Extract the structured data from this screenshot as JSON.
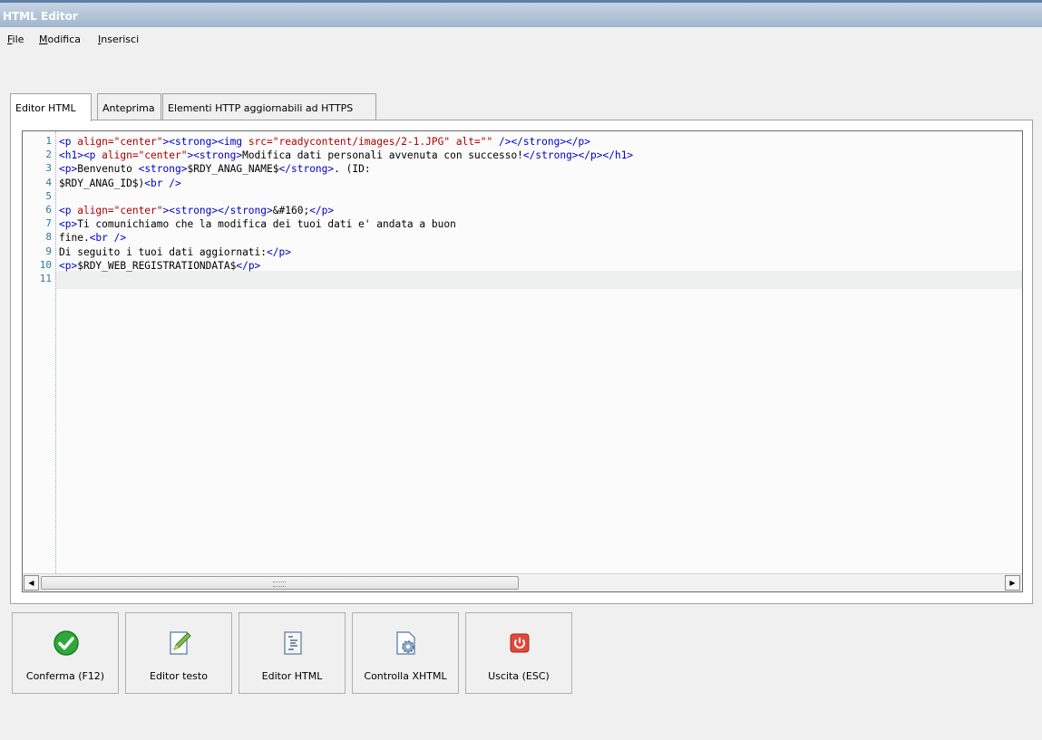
{
  "window": {
    "title": "HTML Editor"
  },
  "menu": [
    {
      "label": "File",
      "key": "F"
    },
    {
      "label": "Modifica",
      "key": "M"
    },
    {
      "label": "Inserisci",
      "key": "I"
    }
  ],
  "tabs": [
    {
      "label": "Editor HTML",
      "active": true
    },
    {
      "label": "Anteprima",
      "active": false
    },
    {
      "label": "Elementi HTTP aggiornabili ad HTTPS",
      "active": false
    }
  ],
  "editor": {
    "current_line": 11,
    "lines": [
      [
        {
          "t": "tag",
          "v": "<p "
        },
        {
          "t": "attr",
          "v": "align=\"center\""
        },
        {
          "t": "tag",
          "v": "><strong><img "
        },
        {
          "t": "attr",
          "v": "src=\"readycontent/images/2-1.JPG\" alt=\"\""
        },
        {
          "t": "tag",
          "v": " /></strong></p>"
        }
      ],
      [
        {
          "t": "tag",
          "v": "<h1><p "
        },
        {
          "t": "attr",
          "v": "align=\"center\""
        },
        {
          "t": "tag",
          "v": "><strong>"
        },
        {
          "t": "text",
          "v": "Modifica dati personali avvenuta con successo!"
        },
        {
          "t": "tag",
          "v": "</strong></p></h1>"
        }
      ],
      [
        {
          "t": "tag",
          "v": "<p>"
        },
        {
          "t": "text",
          "v": "Benvenuto "
        },
        {
          "t": "tag",
          "v": "<strong>"
        },
        {
          "t": "text",
          "v": "$RDY_ANAG_NAME$"
        },
        {
          "t": "tag",
          "v": "</strong>"
        },
        {
          "t": "text",
          "v": ". (ID:"
        }
      ],
      [
        {
          "t": "text",
          "v": "$RDY_ANAG_ID$)"
        },
        {
          "t": "tag",
          "v": "<br />"
        }
      ],
      [],
      [
        {
          "t": "tag",
          "v": "<p "
        },
        {
          "t": "attr",
          "v": "align=\"center\""
        },
        {
          "t": "tag",
          "v": "><strong></strong>"
        },
        {
          "t": "text",
          "v": "&#160;"
        },
        {
          "t": "tag",
          "v": "</p>"
        }
      ],
      [
        {
          "t": "tag",
          "v": "<p>"
        },
        {
          "t": "text",
          "v": "Ti comunichiamo che la modifica dei tuoi dati e' andata a buon"
        }
      ],
      [
        {
          "t": "text",
          "v": "fine."
        },
        {
          "t": "tag",
          "v": "<br />"
        }
      ],
      [
        {
          "t": "text",
          "v": "Di seguito i tuoi dati aggiornati:"
        },
        {
          "t": "tag",
          "v": "</p>"
        }
      ],
      [
        {
          "t": "tag",
          "v": "<p>"
        },
        {
          "t": "text",
          "v": "$RDY_WEB_REGISTRATIONDATA$"
        },
        {
          "t": "tag",
          "v": "</p>"
        }
      ],
      []
    ]
  },
  "buttons": [
    {
      "label": "Conferma (F12)",
      "icon": "check-icon"
    },
    {
      "label": "Editor testo",
      "icon": "edit-document-icon"
    },
    {
      "label": "Editor HTML",
      "icon": "html-list-icon"
    },
    {
      "label": "Controlla XHTML",
      "icon": "gear-document-icon"
    },
    {
      "label": "Uscita (ESC)",
      "icon": "power-icon"
    }
  ],
  "colors": {
    "tag": "#0000c8",
    "attr": "#b00000",
    "line_number": "#2b7b9b",
    "accent": "#5d7fa8"
  }
}
